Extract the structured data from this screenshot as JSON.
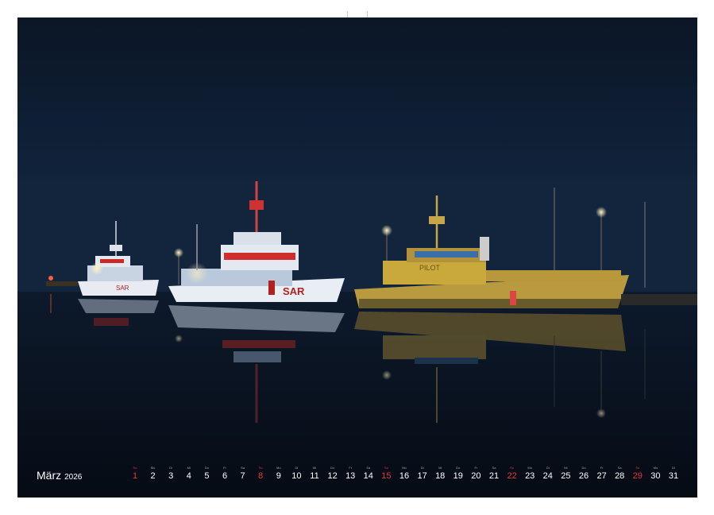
{
  "calendar": {
    "month": "März",
    "year": "2026",
    "days": [
      {
        "wd": "So",
        "n": "1",
        "sunday": true
      },
      {
        "wd": "Mo",
        "n": "2"
      },
      {
        "wd": "Di",
        "n": "3"
      },
      {
        "wd": "Mi",
        "n": "4"
      },
      {
        "wd": "Do",
        "n": "5"
      },
      {
        "wd": "Fr",
        "n": "6"
      },
      {
        "wd": "Sa",
        "n": "7"
      },
      {
        "wd": "So",
        "n": "8",
        "sunday": true
      },
      {
        "wd": "Mo",
        "n": "9"
      },
      {
        "wd": "Di",
        "n": "10"
      },
      {
        "wd": "Mi",
        "n": "11"
      },
      {
        "wd": "Do",
        "n": "12"
      },
      {
        "wd": "Fr",
        "n": "13"
      },
      {
        "wd": "Sa",
        "n": "14"
      },
      {
        "wd": "So",
        "n": "15",
        "sunday": true
      },
      {
        "wd": "Mo",
        "n": "16"
      },
      {
        "wd": "Di",
        "n": "17"
      },
      {
        "wd": "Mi",
        "n": "18"
      },
      {
        "wd": "Do",
        "n": "19"
      },
      {
        "wd": "Fr",
        "n": "20"
      },
      {
        "wd": "Sa",
        "n": "21"
      },
      {
        "wd": "So",
        "n": "22",
        "sunday": true
      },
      {
        "wd": "Mo",
        "n": "23"
      },
      {
        "wd": "Di",
        "n": "24"
      },
      {
        "wd": "Mi",
        "n": "25"
      },
      {
        "wd": "Do",
        "n": "26"
      },
      {
        "wd": "Fr",
        "n": "27"
      },
      {
        "wd": "Sa",
        "n": "28"
      },
      {
        "wd": "So",
        "n": "29",
        "sunday": true
      },
      {
        "wd": "Mo",
        "n": "30"
      },
      {
        "wd": "Di",
        "n": "31"
      }
    ]
  },
  "photo": {
    "boat_marking_left": "SAR",
    "boat_marking_center": "SAR",
    "boat_marking_pilot": "PILOT"
  },
  "colors": {
    "sky": "#0c1a2d",
    "water": "#070d18",
    "sunday_red": "#e03a3a",
    "pilot_yellow": "#c9a83a"
  }
}
